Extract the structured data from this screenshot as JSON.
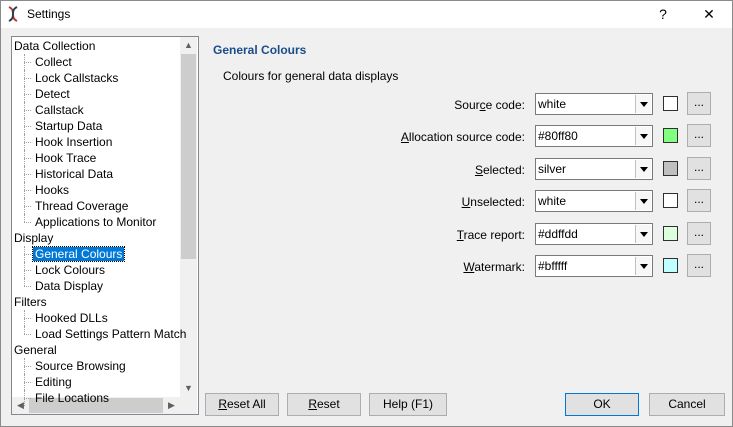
{
  "window": {
    "title": "Settings",
    "help_glyph": "?",
    "close_glyph": "✕"
  },
  "tree": {
    "items": [
      {
        "label": "Data Collection",
        "level": 0
      },
      {
        "label": "Collect",
        "level": 1
      },
      {
        "label": "Lock Callstacks",
        "level": 1
      },
      {
        "label": "Detect",
        "level": 1
      },
      {
        "label": "Callstack",
        "level": 1
      },
      {
        "label": "Startup Data",
        "level": 1
      },
      {
        "label": "Hook Insertion",
        "level": 1
      },
      {
        "label": "Hook Trace",
        "level": 1
      },
      {
        "label": "Historical Data",
        "level": 1
      },
      {
        "label": "Hooks",
        "level": 1
      },
      {
        "label": "Thread Coverage",
        "level": 1
      },
      {
        "label": "Applications to Monitor",
        "level": 1,
        "last": true
      },
      {
        "label": "Display",
        "level": 0
      },
      {
        "label": "General Colours",
        "level": 1,
        "selected": true
      },
      {
        "label": "Lock Colours",
        "level": 1
      },
      {
        "label": "Data Display",
        "level": 1,
        "last": true
      },
      {
        "label": "Filters",
        "level": 0
      },
      {
        "label": "Hooked DLLs",
        "level": 1
      },
      {
        "label": "Load Settings Pattern Match",
        "level": 1,
        "last": true
      },
      {
        "label": "General",
        "level": 0
      },
      {
        "label": "Source Browsing",
        "level": 1
      },
      {
        "label": "Editing",
        "level": 1
      },
      {
        "label": "File Locations",
        "level": 1
      }
    ],
    "scroll": {
      "up": "▲",
      "down": "▼",
      "left": "◀",
      "right": "▶"
    }
  },
  "panel": {
    "heading": "General Colours",
    "description": "Colours for general data displays",
    "colour_rows": [
      {
        "label": "Source code:",
        "accel": "c",
        "value": "white",
        "swatch": "#ffffff"
      },
      {
        "label": "Allocation source code:",
        "accel": "A",
        "value": "#80ff80",
        "swatch": "#80ff80"
      },
      {
        "label": "Selected:",
        "accel": "S",
        "value": "silver",
        "swatch": "#c0c0c0"
      },
      {
        "label": "Unselected:",
        "accel": "U",
        "value": "white",
        "swatch": "#ffffff"
      },
      {
        "label": "Trace report:",
        "accel": "T",
        "value": "#ddffdd",
        "swatch": "#ddffdd"
      },
      {
        "label": "Watermark:",
        "accel": "W",
        "value": "#bfffff",
        "swatch": "#bfffff"
      }
    ],
    "browse_label": "..."
  },
  "buttons": {
    "reset_all": {
      "label": "Reset All",
      "accel": "R"
    },
    "reset": {
      "label": "Reset",
      "accel": "R"
    },
    "help": {
      "label": "Help (F1)"
    },
    "ok": {
      "label": "OK"
    },
    "cancel": {
      "label": "Cancel"
    }
  }
}
